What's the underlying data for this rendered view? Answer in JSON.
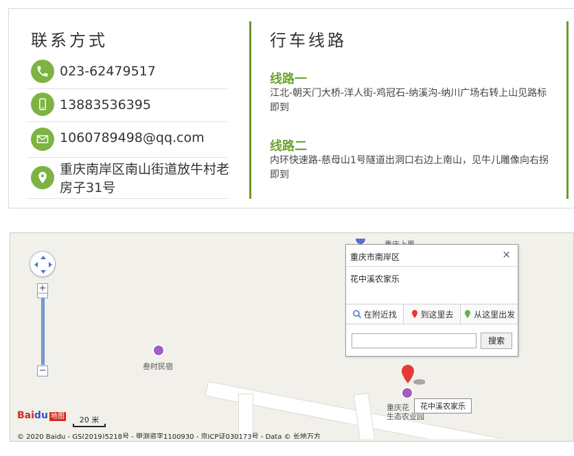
{
  "contact": {
    "title": "联系方式",
    "phone": "023-62479517",
    "mobile": "13883536395",
    "email": "1060789498@qq.com",
    "address": "重庆南岸区南山街道放牛村老房子31号",
    "icons": [
      "phone-icon",
      "mobile-icon",
      "mail-icon",
      "location-pin-icon"
    ]
  },
  "route": {
    "title": "行车线路",
    "items": [
      {
        "title": "线路一",
        "desc": "江北-朝天门大桥-洋人街-鸡冠石-纳溪沟-纳川广场右转上山见路标即到"
      },
      {
        "title": "线路二",
        "desc": "内环快速路-慈母山1号隧道出洞口右边上南山，见牛儿雕像向右拐即到"
      }
    ]
  },
  "map": {
    "poi_homestay": "叁时民宿",
    "poi_top_partial": "重庆上界",
    "bubble": {
      "title": "重庆市南岸区",
      "close": "×",
      "name": "花中溪农家乐",
      "tab_nearby": "在附近找",
      "tab_to_here": "到这里去",
      "tab_from_here": "从这里出发",
      "search_button": "搜索",
      "search_value": ""
    },
    "marker_label": "花中溪农家乐",
    "dest_poi_line1": "重庆花",
    "dest_poi_line2": "生态农业园",
    "logo_text": "Bai",
    "logo_paw": "du",
    "logo_badge": "地图",
    "scale_label": "20 米",
    "copyright": "© 2020 Baidu - GS(2019)5218号 - 甲测资字1100930 - 京ICP证030173号 - Data © 长地万方"
  },
  "colors": {
    "accent_green": "#7cb342",
    "route_title_green": "#6aa42f",
    "divider_green": "#6a9a2b",
    "marker_red": "#e53935",
    "poi_purple": "#9e5fbf"
  }
}
